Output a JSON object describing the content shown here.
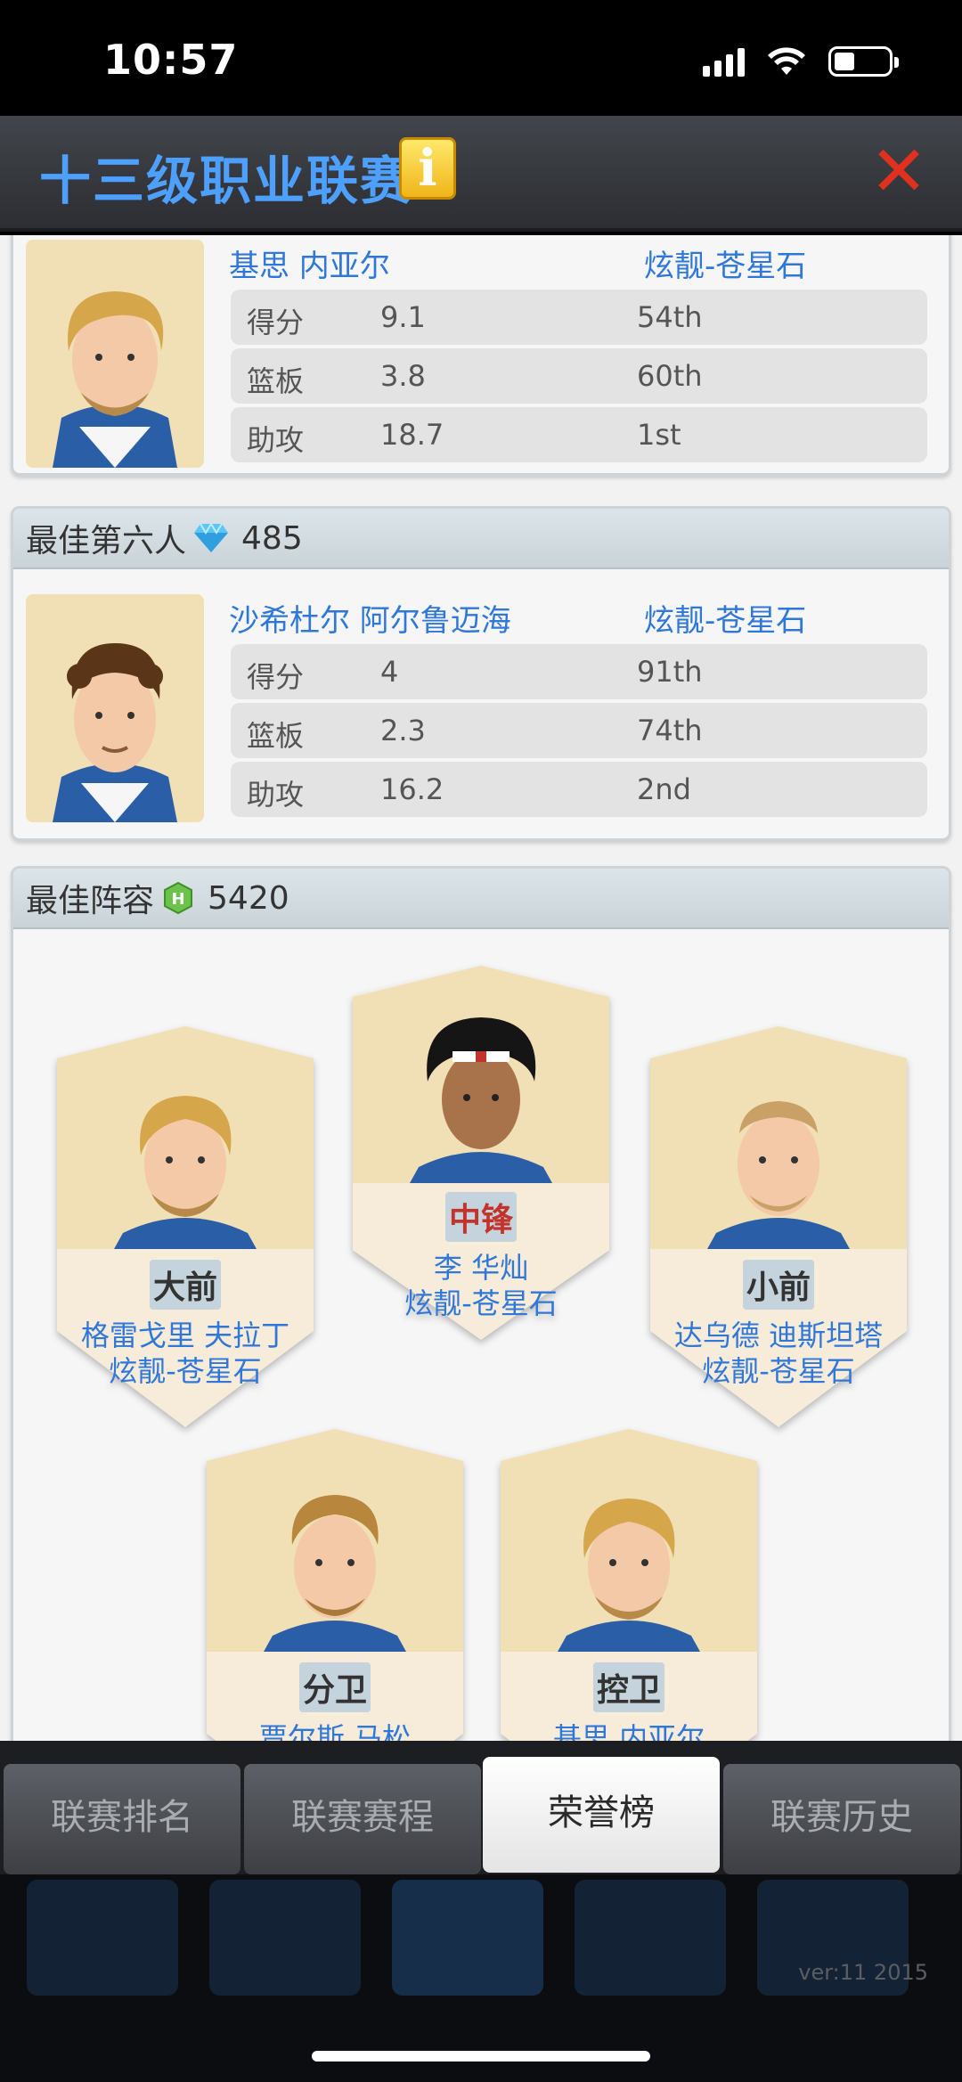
{
  "status": {
    "time": "10:57"
  },
  "header": {
    "title": "十三级职业联赛",
    "info_icon": "info-icon",
    "close_icon": "close-icon"
  },
  "stat_labels": [
    "得分",
    "篮板",
    "助攻"
  ],
  "top_card": {
    "name": "基思 内亚尔",
    "team": "炫靓-苍星石",
    "stats": [
      {
        "label": "得分",
        "value": "9.1",
        "rank": "54th"
      },
      {
        "label": "篮板",
        "value": "3.8",
        "rank": "60th"
      },
      {
        "label": "助攻",
        "value": "18.7",
        "rank": "1st"
      }
    ]
  },
  "sixth_man": {
    "title": "最佳第六人",
    "value": "485",
    "name": "沙希杜尔 阿尔鲁迈海",
    "team": "炫靓-苍星石",
    "stats": [
      {
        "label": "得分",
        "value": "4",
        "rank": "91th"
      },
      {
        "label": "篮板",
        "value": "2.3",
        "rank": "74th"
      },
      {
        "label": "助攻",
        "value": "16.2",
        "rank": "2nd"
      }
    ]
  },
  "lineup": {
    "title": "最佳阵容",
    "value": "5420",
    "players": [
      {
        "position": "大前",
        "name": "格雷戈里 夫拉丁",
        "team": "炫靓-苍星石"
      },
      {
        "position": "中锋",
        "name": "李 华灿",
        "team": "炫靓-苍星石"
      },
      {
        "position": "小前",
        "name": "达乌德 迪斯坦塔",
        "team": "炫靓-苍星石"
      },
      {
        "position": "分卫",
        "name": "贾尔斯 马松",
        "team": ""
      },
      {
        "position": "控卫",
        "name": "基思 内亚尔",
        "team": ""
      }
    ]
  },
  "tabs": [
    {
      "label": "联赛排名",
      "active": false
    },
    {
      "label": "联赛赛程",
      "active": false
    },
    {
      "label": "荣誉榜",
      "active": true
    },
    {
      "label": "联赛历史",
      "active": false
    }
  ],
  "footer": {
    "version": "ver:11  2015"
  },
  "colors": {
    "accent_blue": "#2f77d9",
    "title_blue": "#4da0ff",
    "close_red": "#e0301e"
  }
}
